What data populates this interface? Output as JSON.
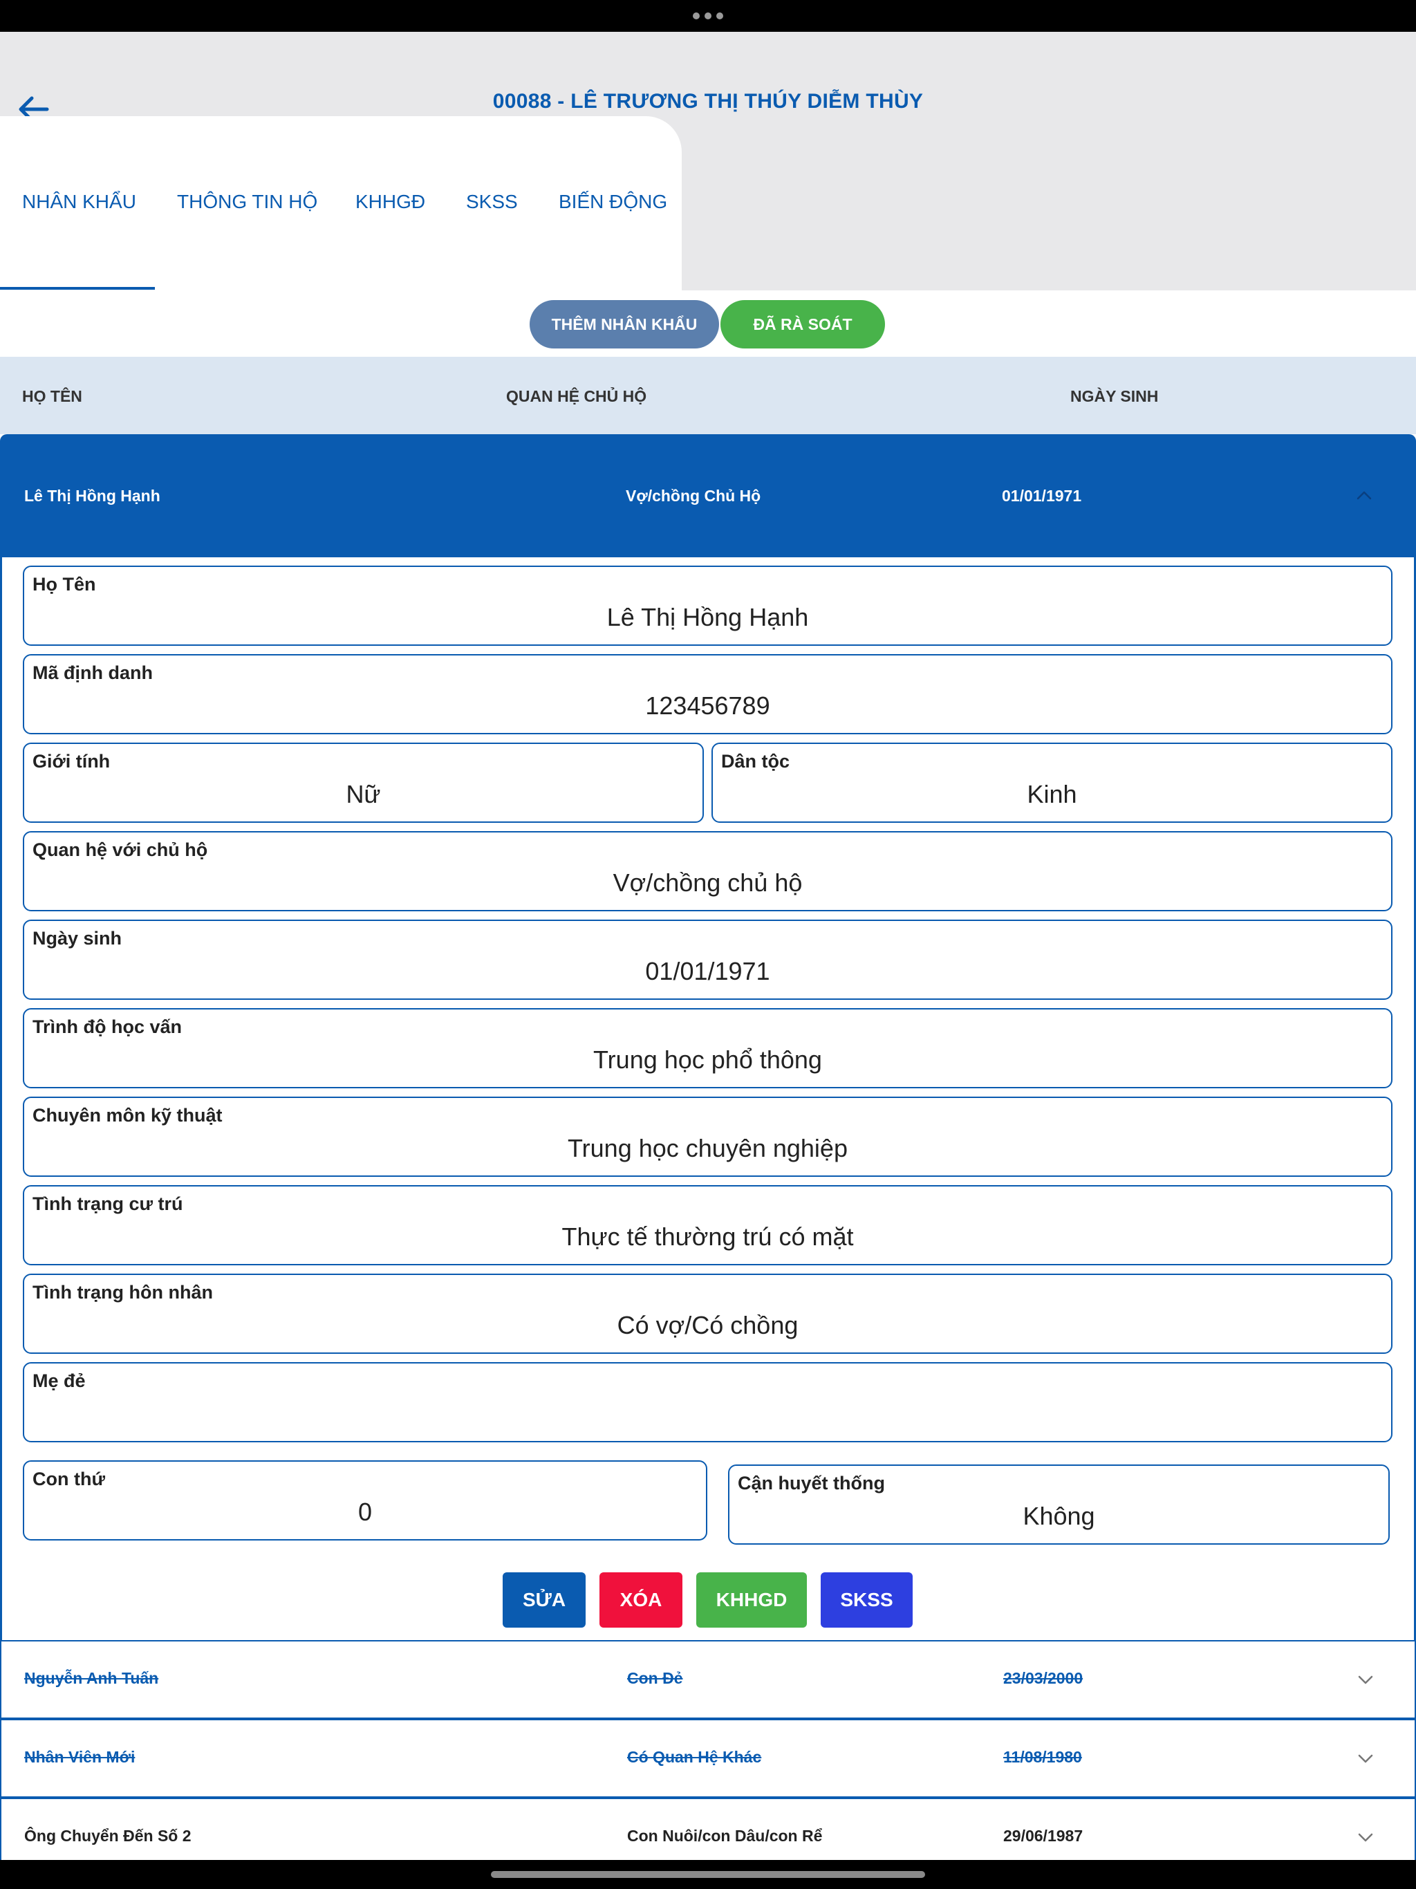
{
  "header": {
    "title": "00088 - LÊ TRƯƠNG THỊ THÚY DIỄM THÙY"
  },
  "tabs": [
    {
      "label": "NHÂN KHẨU",
      "active": true
    },
    {
      "label": "THÔNG TIN HỘ",
      "active": false
    },
    {
      "label": "KHHGĐ",
      "active": false
    },
    {
      "label": "SKSS",
      "active": false
    },
    {
      "label": "BIẾN ĐỘNG",
      "active": false
    }
  ],
  "actions": {
    "add_member": "THÊM NHÂN KHẨU",
    "reviewed": "ĐÃ RÀ SOÁT"
  },
  "table": {
    "headers": [
      "HỌ TÊN",
      "QUAN HỆ CHỦ HỘ",
      "NGÀY SINH"
    ],
    "active_row": {
      "name": "Lê Thị Hồng Hạnh",
      "relation": "Vợ/chồng Chủ Hộ",
      "dob": "01/01/1971"
    },
    "rows": [
      {
        "name": "Nguyễn Anh Tuấn",
        "relation": "Con Đẻ",
        "dob": "23/03/2000",
        "struck": true
      },
      {
        "name": "Nhân Viên Mới",
        "relation": "Có Quan Hệ Khác",
        "dob": "11/08/1980",
        "struck": true
      },
      {
        "name": "Ông Chuyển Đến Số 2",
        "relation": "Con Nuôi/con Dâu/con Rể",
        "dob": "29/06/1987",
        "struck": false
      }
    ]
  },
  "detail": {
    "full_name": {
      "label": "Họ Tên",
      "value": "Lê Thị Hồng Hạnh"
    },
    "id_code": {
      "label": "Mã định danh",
      "value": "123456789"
    },
    "gender": {
      "label": "Giới tính",
      "value": "Nữ"
    },
    "ethnicity": {
      "label": "Dân tộc",
      "value": "Kinh"
    },
    "relation": {
      "label": "Quan hệ với chủ hộ",
      "value": "Vợ/chồng chủ hộ"
    },
    "dob": {
      "label": "Ngày sinh",
      "value": "01/01/1971"
    },
    "education": {
      "label": "Trình độ học vấn",
      "value": "Trung học phổ thông"
    },
    "technical": {
      "label": "Chuyên môn kỹ thuật",
      "value": "Trung học chuyên nghiệp"
    },
    "residence": {
      "label": "Tình trạng cư trú",
      "value": "Thực tế thường trú có mặt"
    },
    "marital": {
      "label": "Tình trạng hôn nhân",
      "value": "Có vợ/Có chồng"
    },
    "mother": {
      "label": "Mẹ đẻ",
      "value": ""
    },
    "child_order": {
      "label": "Con thứ",
      "value": "0"
    },
    "consanguinity": {
      "label": "Cận huyết thống",
      "value": "Không"
    }
  },
  "detail_actions": {
    "edit": "SỬA",
    "delete": "XÓA",
    "khhgd": "KHHGD",
    "skss": "SKSS"
  },
  "colors": {
    "primary": "#0a5bb0",
    "green": "#48b34a",
    "red": "#f0113c",
    "indigo": "#2d3fe0",
    "slate": "#5b7fad",
    "header_bg": "#dbe6f2",
    "topbar_bg": "#e8e8ea"
  },
  "icons": {
    "back": "arrow-left-icon",
    "expand": "chevron-down-icon",
    "collapse": "chevron-up-icon"
  }
}
